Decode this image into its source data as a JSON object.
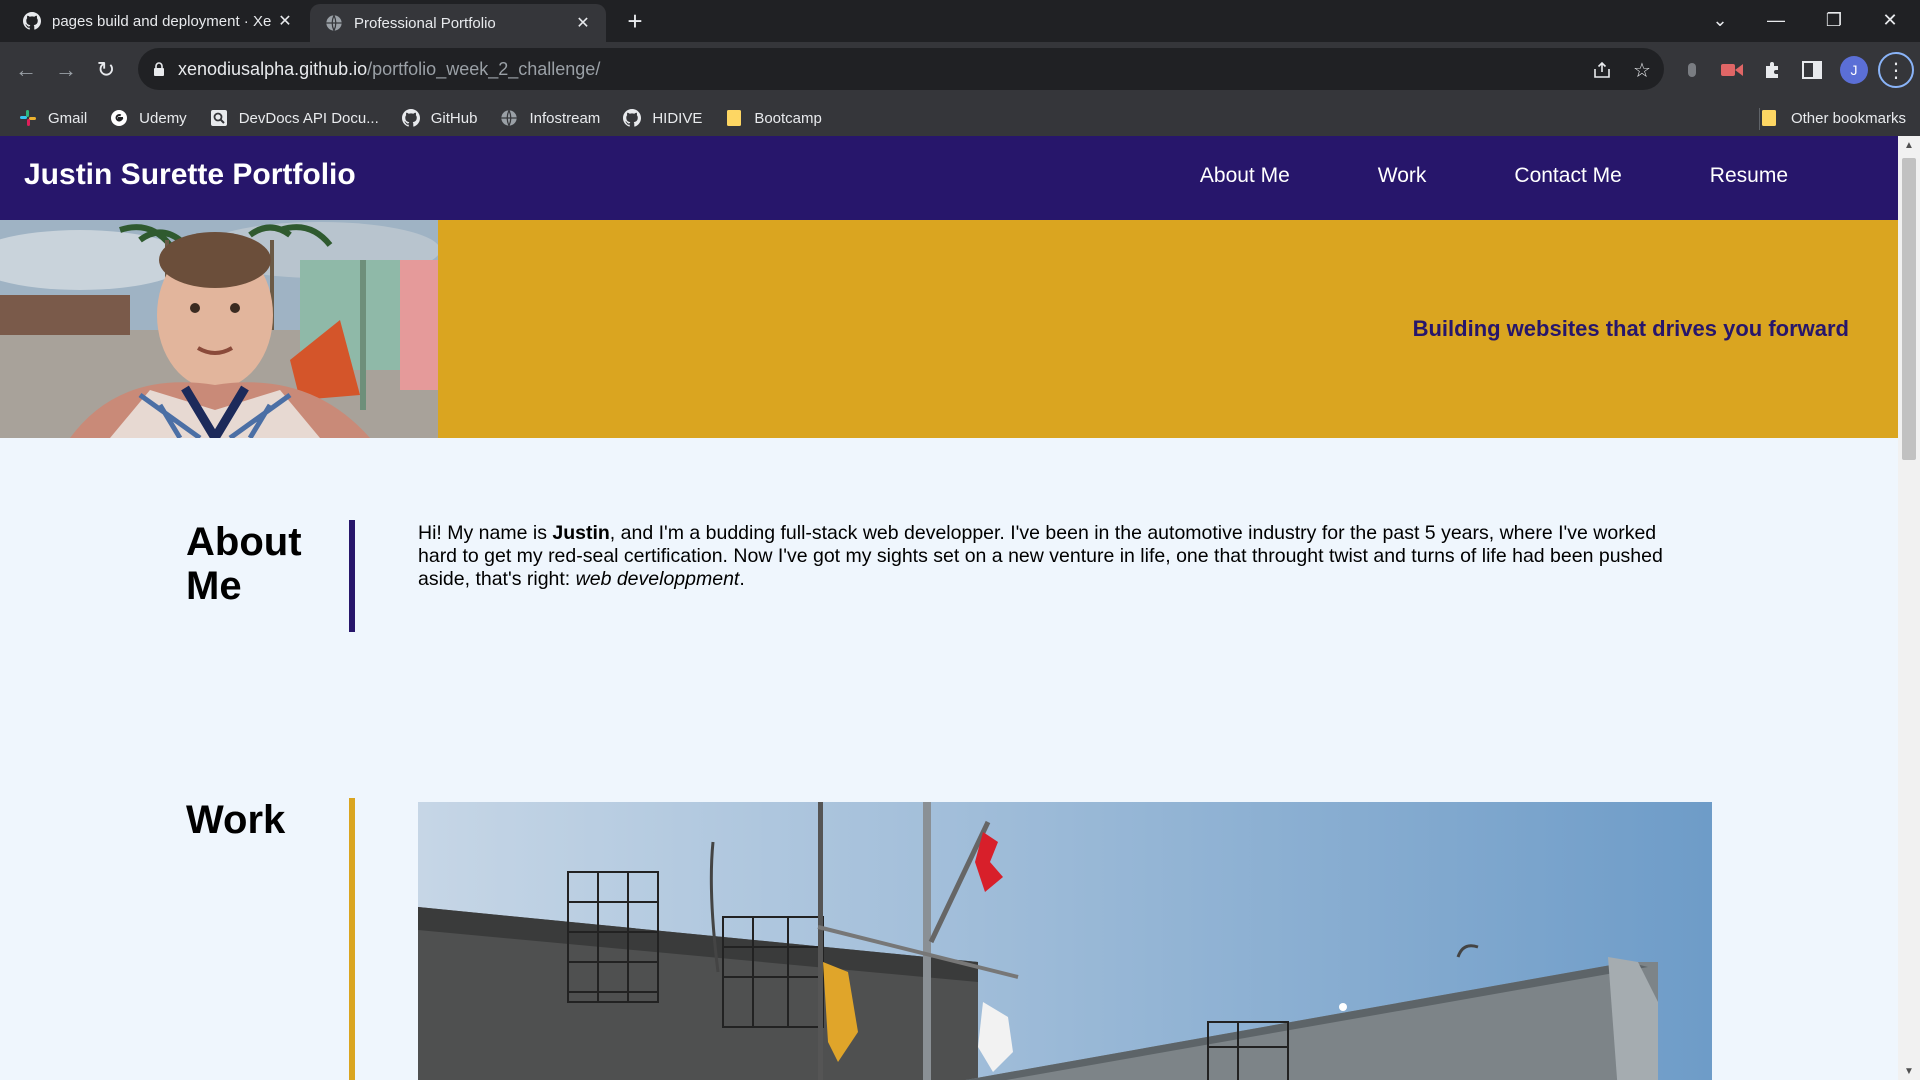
{
  "browser": {
    "tabs": [
      {
        "title": "pages build and deployment · Xe",
        "icon": "github-icon"
      },
      {
        "title": "Professional Portfolio",
        "icon": "globe-icon"
      }
    ],
    "url_host": "xenodiusalpha.github.io",
    "url_path": "/portfolio_week_2_challenge/",
    "profile_initial": "J",
    "bookmarks": [
      {
        "label": "Gmail",
        "icon": "slack-icon"
      },
      {
        "label": "Udemy",
        "icon": "google-icon"
      },
      {
        "label": "DevDocs API Docu...",
        "icon": "devdocs-icon"
      },
      {
        "label": "GitHub",
        "icon": "github-icon"
      },
      {
        "label": "Infostream",
        "icon": "globe-icon"
      },
      {
        "label": "HIDIVE",
        "icon": "github-icon"
      },
      {
        "label": "Bootcamp",
        "icon": "folder-icon"
      }
    ],
    "other_bookmarks": "Other bookmarks"
  },
  "site": {
    "title": "Justin Surette Portfolio",
    "nav": [
      "About Me",
      "Work",
      "Contact Me",
      "Resume"
    ],
    "tagline": "Building websites that drives you forward",
    "about": {
      "heading_line1": "About",
      "heading_line2": "Me",
      "text_intro": "Hi! My name is ",
      "text_name": "Justin",
      "text_body": ", and I'm a budding full-stack web developper. I've been in the automotive industry for the past 5 years, where I've worked hard to get my red-seal certification. Now I've got my sights set on a new venture in life, one that throught twist and turns of life had been pushed aside, that's right: ",
      "text_em": "web developpment",
      "text_end": "."
    },
    "work": {
      "heading": "Work"
    }
  },
  "colors": {
    "header_bg": "#27166b",
    "hero_bg": "#daa520",
    "page_bg": "#eff6fd"
  }
}
